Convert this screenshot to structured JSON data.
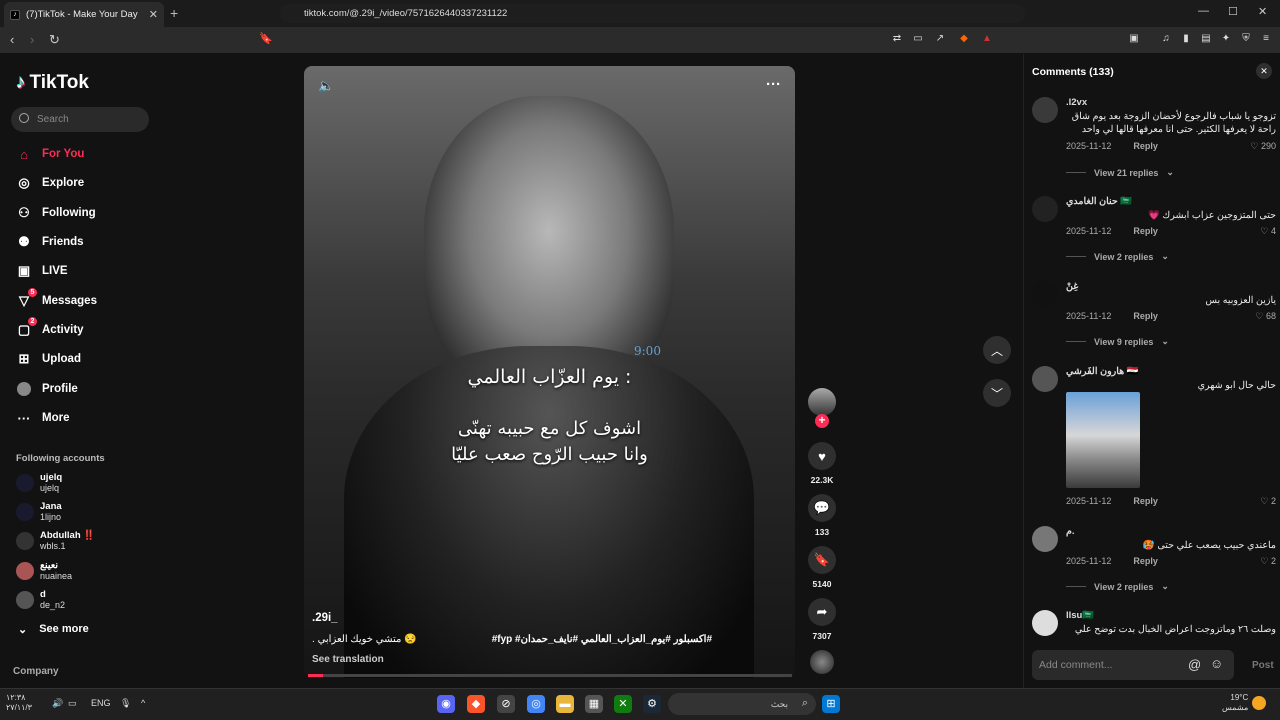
{
  "browser": {
    "tab_title": "(7)TikTok - Make Your Day",
    "tab_close": "✕",
    "new_tab": "+",
    "url": "tiktok.com/@.29i_/video/7571626440337231122",
    "window_controls": [
      "—",
      "☐",
      "✕"
    ]
  },
  "sidebar": {
    "logo": "TikTok",
    "search_placeholder": "Search",
    "nav": [
      {
        "label": "For You",
        "icon": "home-icon",
        "active": true
      },
      {
        "label": "Explore",
        "icon": "compass-icon"
      },
      {
        "label": "Following",
        "icon": "following-icon"
      },
      {
        "label": "Friends",
        "icon": "friends-icon"
      },
      {
        "label": "LIVE",
        "icon": "live-icon"
      },
      {
        "label": "Messages",
        "icon": "messages-icon",
        "badge": "5"
      },
      {
        "label": "Activity",
        "icon": "activity-icon",
        "badge": "2"
      },
      {
        "label": "Upload",
        "icon": "upload-icon"
      },
      {
        "label": "Profile",
        "icon": "profile-icon"
      },
      {
        "label": "More",
        "icon": "more-icon"
      }
    ],
    "following_title": "Following accounts",
    "accounts": [
      {
        "name": "ujelq",
        "handle": "ujelq"
      },
      {
        "name": "Jana",
        "handle": "1lijno"
      },
      {
        "name": "Abdullah ‼️",
        "handle": "wbls.1"
      },
      {
        "name": "نعينع",
        "handle": "nuainea"
      },
      {
        "name": "d",
        "handle": "de_n2"
      }
    ],
    "see_more": "See more",
    "company": "Company"
  },
  "video": {
    "caption_line1": "يوم العزّاب العالمي :",
    "caption_line2": "اشوف كل مع حبيبه تهنّى",
    "caption_line3": "وانا حبيب الرّوح صعب عليّا",
    "clock": "9:00",
    "author": ".29i_",
    "description": ". متشي خويك العزابي 😒",
    "hashtags": "#fyp #اكسبلور #يوم_العزاب_العالمي #نايف_حمدان#",
    "see_translation": "See translation",
    "progress": 0.03
  },
  "actions": {
    "likes": "22.3K",
    "comments": "133",
    "saves": "5140",
    "shares": "7307"
  },
  "comments_panel": {
    "title": "Comments (133)",
    "items": [
      {
        "user": ".l2vx",
        "text": "تزوجو يا شباب فالرجوع لأحضان الزوجة بعد يوم شاق راحة لا يعرفها الكثير. حتى انا معرفها قالها لي واحد",
        "date": "2025-11-12",
        "reply": "Reply",
        "likes": "290",
        "view_replies": "View 21 replies"
      },
      {
        "user": "حنان الغامدي 🇸🇦",
        "text": "حتى المتزوجين عزاب ابشرك 💗",
        "date": "2025-11-12",
        "reply": "Reply",
        "likes": "4",
        "view_replies": "View 2 replies"
      },
      {
        "user": "غِنْ",
        "text": "يازين العزوبيه بس",
        "date": "2025-11-12",
        "reply": "Reply",
        "likes": "68",
        "view_replies": "View 9 replies"
      },
      {
        "user": "هارون الفَرشي 🇮🇶",
        "text": "حالي حال ابو شهري",
        "date": "2025-11-12",
        "reply": "Reply",
        "likes": "2"
      },
      {
        "user": "م.",
        "text": "ماعندي حبيب يصعب علي حتى 🥵",
        "date": "2025-11-12",
        "reply": "Reply",
        "likes": "2",
        "view_replies": "View 2 replies"
      },
      {
        "user": "llsu🇸🇦",
        "text": "وصلت ٢٦ وماتزوجت اعراض الخبال بدت توضح علي"
      }
    ],
    "add_placeholder": "Add comment...",
    "post": "Post"
  },
  "taskbar": {
    "search_placeholder": "بحث",
    "lang": "ENG",
    "time": "١٢:٣٨",
    "date": "٢٧/١١/٣",
    "weather": "19°C",
    "weather_desc": "مشمس"
  },
  "colors": {
    "brand": "#fe2c55",
    "bg": "#121212"
  }
}
